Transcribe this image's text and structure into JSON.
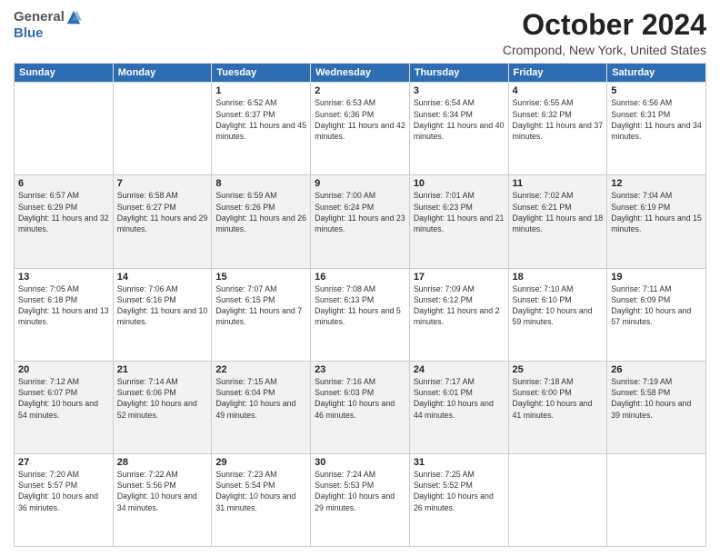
{
  "header": {
    "logo_general": "General",
    "logo_blue": "Blue",
    "month_title": "October 2024",
    "subtitle": "Crompond, New York, United States"
  },
  "days_of_week": [
    "Sunday",
    "Monday",
    "Tuesday",
    "Wednesday",
    "Thursday",
    "Friday",
    "Saturday"
  ],
  "weeks": [
    [
      {
        "num": "",
        "sunrise": "",
        "sunset": "",
        "daylight": "",
        "empty": true
      },
      {
        "num": "",
        "sunrise": "",
        "sunset": "",
        "daylight": "",
        "empty": true
      },
      {
        "num": "1",
        "sunrise": "Sunrise: 6:52 AM",
        "sunset": "Sunset: 6:37 PM",
        "daylight": "Daylight: 11 hours and 45 minutes."
      },
      {
        "num": "2",
        "sunrise": "Sunrise: 6:53 AM",
        "sunset": "Sunset: 6:36 PM",
        "daylight": "Daylight: 11 hours and 42 minutes."
      },
      {
        "num": "3",
        "sunrise": "Sunrise: 6:54 AM",
        "sunset": "Sunset: 6:34 PM",
        "daylight": "Daylight: 11 hours and 40 minutes."
      },
      {
        "num": "4",
        "sunrise": "Sunrise: 6:55 AM",
        "sunset": "Sunset: 6:32 PM",
        "daylight": "Daylight: 11 hours and 37 minutes."
      },
      {
        "num": "5",
        "sunrise": "Sunrise: 6:56 AM",
        "sunset": "Sunset: 6:31 PM",
        "daylight": "Daylight: 11 hours and 34 minutes."
      }
    ],
    [
      {
        "num": "6",
        "sunrise": "Sunrise: 6:57 AM",
        "sunset": "Sunset: 6:29 PM",
        "daylight": "Daylight: 11 hours and 32 minutes."
      },
      {
        "num": "7",
        "sunrise": "Sunrise: 6:58 AM",
        "sunset": "Sunset: 6:27 PM",
        "daylight": "Daylight: 11 hours and 29 minutes."
      },
      {
        "num": "8",
        "sunrise": "Sunrise: 6:59 AM",
        "sunset": "Sunset: 6:26 PM",
        "daylight": "Daylight: 11 hours and 26 minutes."
      },
      {
        "num": "9",
        "sunrise": "Sunrise: 7:00 AM",
        "sunset": "Sunset: 6:24 PM",
        "daylight": "Daylight: 11 hours and 23 minutes."
      },
      {
        "num": "10",
        "sunrise": "Sunrise: 7:01 AM",
        "sunset": "Sunset: 6:23 PM",
        "daylight": "Daylight: 11 hours and 21 minutes."
      },
      {
        "num": "11",
        "sunrise": "Sunrise: 7:02 AM",
        "sunset": "Sunset: 6:21 PM",
        "daylight": "Daylight: 11 hours and 18 minutes."
      },
      {
        "num": "12",
        "sunrise": "Sunrise: 7:04 AM",
        "sunset": "Sunset: 6:19 PM",
        "daylight": "Daylight: 11 hours and 15 minutes."
      }
    ],
    [
      {
        "num": "13",
        "sunrise": "Sunrise: 7:05 AM",
        "sunset": "Sunset: 6:18 PM",
        "daylight": "Daylight: 11 hours and 13 minutes."
      },
      {
        "num": "14",
        "sunrise": "Sunrise: 7:06 AM",
        "sunset": "Sunset: 6:16 PM",
        "daylight": "Daylight: 11 hours and 10 minutes."
      },
      {
        "num": "15",
        "sunrise": "Sunrise: 7:07 AM",
        "sunset": "Sunset: 6:15 PM",
        "daylight": "Daylight: 11 hours and 7 minutes."
      },
      {
        "num": "16",
        "sunrise": "Sunrise: 7:08 AM",
        "sunset": "Sunset: 6:13 PM",
        "daylight": "Daylight: 11 hours and 5 minutes."
      },
      {
        "num": "17",
        "sunrise": "Sunrise: 7:09 AM",
        "sunset": "Sunset: 6:12 PM",
        "daylight": "Daylight: 11 hours and 2 minutes."
      },
      {
        "num": "18",
        "sunrise": "Sunrise: 7:10 AM",
        "sunset": "Sunset: 6:10 PM",
        "daylight": "Daylight: 10 hours and 59 minutes."
      },
      {
        "num": "19",
        "sunrise": "Sunrise: 7:11 AM",
        "sunset": "Sunset: 6:09 PM",
        "daylight": "Daylight: 10 hours and 57 minutes."
      }
    ],
    [
      {
        "num": "20",
        "sunrise": "Sunrise: 7:12 AM",
        "sunset": "Sunset: 6:07 PM",
        "daylight": "Daylight: 10 hours and 54 minutes."
      },
      {
        "num": "21",
        "sunrise": "Sunrise: 7:14 AM",
        "sunset": "Sunset: 6:06 PM",
        "daylight": "Daylight: 10 hours and 52 minutes."
      },
      {
        "num": "22",
        "sunrise": "Sunrise: 7:15 AM",
        "sunset": "Sunset: 6:04 PM",
        "daylight": "Daylight: 10 hours and 49 minutes."
      },
      {
        "num": "23",
        "sunrise": "Sunrise: 7:16 AM",
        "sunset": "Sunset: 6:03 PM",
        "daylight": "Daylight: 10 hours and 46 minutes."
      },
      {
        "num": "24",
        "sunrise": "Sunrise: 7:17 AM",
        "sunset": "Sunset: 6:01 PM",
        "daylight": "Daylight: 10 hours and 44 minutes."
      },
      {
        "num": "25",
        "sunrise": "Sunrise: 7:18 AM",
        "sunset": "Sunset: 6:00 PM",
        "daylight": "Daylight: 10 hours and 41 minutes."
      },
      {
        "num": "26",
        "sunrise": "Sunrise: 7:19 AM",
        "sunset": "Sunset: 5:58 PM",
        "daylight": "Daylight: 10 hours and 39 minutes."
      }
    ],
    [
      {
        "num": "27",
        "sunrise": "Sunrise: 7:20 AM",
        "sunset": "Sunset: 5:57 PM",
        "daylight": "Daylight: 10 hours and 36 minutes."
      },
      {
        "num": "28",
        "sunrise": "Sunrise: 7:22 AM",
        "sunset": "Sunset: 5:56 PM",
        "daylight": "Daylight: 10 hours and 34 minutes."
      },
      {
        "num": "29",
        "sunrise": "Sunrise: 7:23 AM",
        "sunset": "Sunset: 5:54 PM",
        "daylight": "Daylight: 10 hours and 31 minutes."
      },
      {
        "num": "30",
        "sunrise": "Sunrise: 7:24 AM",
        "sunset": "Sunset: 5:53 PM",
        "daylight": "Daylight: 10 hours and 29 minutes."
      },
      {
        "num": "31",
        "sunrise": "Sunrise: 7:25 AM",
        "sunset": "Sunset: 5:52 PM",
        "daylight": "Daylight: 10 hours and 26 minutes."
      },
      {
        "num": "",
        "sunrise": "",
        "sunset": "",
        "daylight": "",
        "empty": true
      },
      {
        "num": "",
        "sunrise": "",
        "sunset": "",
        "daylight": "",
        "empty": true
      }
    ]
  ]
}
